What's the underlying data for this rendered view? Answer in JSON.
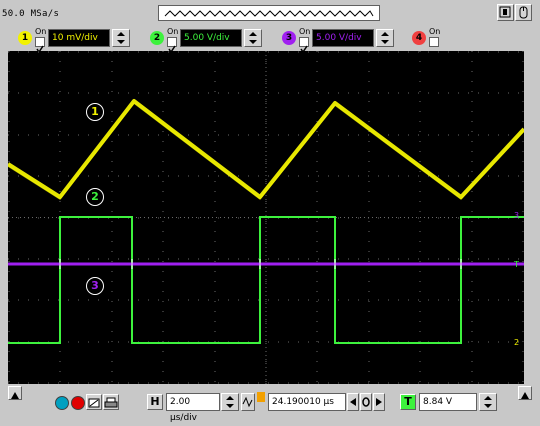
{
  "top": {
    "sample_rate": "50.0 MSa/s"
  },
  "channels": [
    {
      "num": "1",
      "on_label": "On",
      "enabled": true,
      "scale": "10 mV/div",
      "color": "#f2f200"
    },
    {
      "num": "2",
      "on_label": "On",
      "enabled": true,
      "scale": "5.00 V/div",
      "color": "#3df23d"
    },
    {
      "num": "3",
      "on_label": "On",
      "enabled": true,
      "scale": "5.00 V/div",
      "color": "#a020f0"
    },
    {
      "num": "4",
      "on_label": "On",
      "enabled": false,
      "scale": "",
      "color": "#f04040"
    }
  ],
  "trace_labels": {
    "ch1": "1",
    "ch2": "2",
    "ch3": "3"
  },
  "screen_markers": {
    "trigger_marker": "T",
    "ch2_ground": "2",
    "ch3_ground": "3"
  },
  "bottom": {
    "horizontal_icon": "H",
    "time_per_div": "2.00 µs/div",
    "delay": "24.190010 µs",
    "trigger_icon": "T",
    "trigger_level": "8.84 V"
  },
  "colors": {
    "ch1": "#f2f200",
    "ch2": "#3df23d",
    "ch3": "#a020f0",
    "ch4": "#f04040",
    "grid": "#6a6a6a"
  }
}
